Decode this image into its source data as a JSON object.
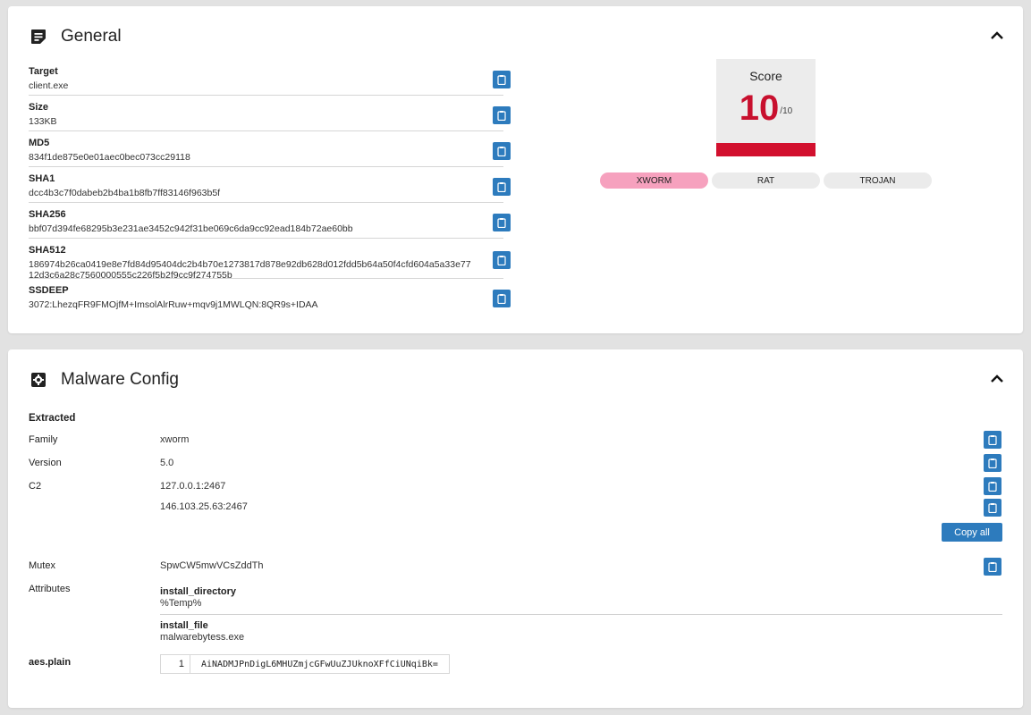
{
  "general": {
    "title": "General",
    "fields": [
      {
        "label": "Target",
        "value": "client.exe"
      },
      {
        "label": "Size",
        "value": "133KB"
      },
      {
        "label": "MD5",
        "value": "834f1de875e0e01aec0bec073cc29118"
      },
      {
        "label": "SHA1",
        "value": "dcc4b3c7f0dabeb2b4ba1b8fb7ff83146f963b5f"
      },
      {
        "label": "SHA256",
        "value": "bbf07d394fe68295b3e231ae3452c942f31be069c6da9cc92ead184b72ae60bb"
      },
      {
        "label": "SHA512",
        "value": "186974b26ca0419e8e7fd84d95404dc2b4b70e1273817d878e92db628d012fdd5b64a50f4cfd604a5a33e7712d3c6a28c7560000555c226f5b2f9cc9f274755b"
      },
      {
        "label": "SSDEEP",
        "value": "3072:LhezqFR9FMOjfM+ImsolAlrRuw+mqv9j1MWLQN:8QR9s+IDAA"
      }
    ],
    "score": {
      "label": "Score",
      "value": "10",
      "out_of": "/10",
      "fraction": 1.0,
      "color": "#d2102e"
    },
    "tags": [
      "XWORM",
      "RAT",
      "TROJAN"
    ],
    "primary_tag_color": "#f6a1be"
  },
  "config": {
    "title": "Malware Config",
    "extracted_title": "Extracted",
    "family_label": "Family",
    "family_value": "xworm",
    "version_label": "Version",
    "version_value": "5.0",
    "c2_label": "C2",
    "c2_values": [
      "127.0.0.1:2467",
      "146.103.25.63:2467"
    ],
    "copy_all_label": "Copy all",
    "mutex_label": "Mutex",
    "mutex_value": "SpwCW5mwVCsZddTh",
    "attributes_label": "Attributes",
    "attributes": [
      {
        "name": "install_directory",
        "value": "%Temp%"
      },
      {
        "name": "install_file",
        "value": "malwarebytess.exe"
      }
    ],
    "aes_label": "aes.plain",
    "aes_line": "1",
    "aes_value": "AiNADMJPnDigL6MHUZmjcGFwUuZJUknoXFfCiUNqiBk="
  },
  "icons": {
    "general": "note-icon",
    "config": "gear-icon",
    "collapse": "chevron-up-icon",
    "copy": "clipboard-icon"
  },
  "accent_color": "#2d7bbd"
}
